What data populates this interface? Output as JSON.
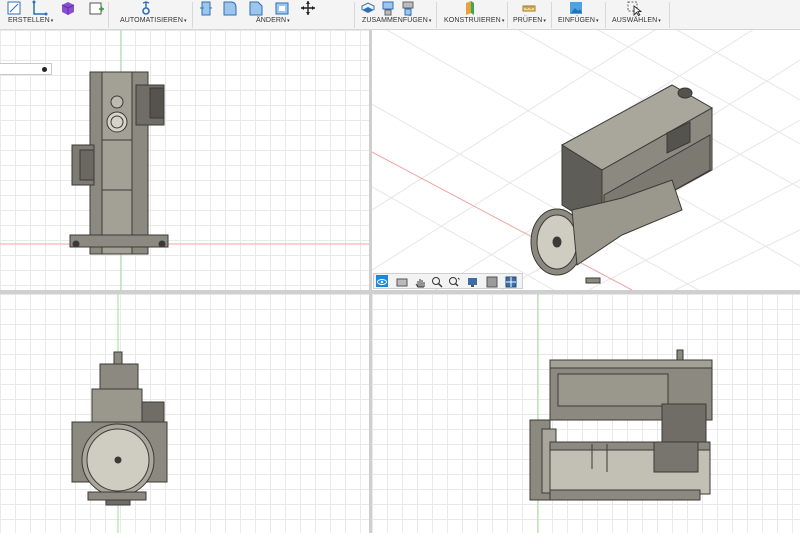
{
  "toolbar": {
    "groups": [
      {
        "label": "ERSTELLEN",
        "icons": [
          "sketch-icon",
          "line-icon",
          "box-icon",
          "create-form-icon"
        ]
      },
      {
        "label": "AUTOMATISIEREN",
        "icons": [
          "automate-icon"
        ]
      },
      {
        "label": "ÄNDERN",
        "icons": [
          "press-pull-icon",
          "fillet-icon",
          "chamfer-icon",
          "shell-icon",
          "move-icon"
        ]
      },
      {
        "label": "ZUSAMMENFÜGEN",
        "icons": [
          "component-icon",
          "joint-icon",
          "as-built-joint-icon"
        ]
      },
      {
        "label": "KONSTRUIEREN",
        "icons": [
          "plane-icon"
        ]
      },
      {
        "label": "PRÜFEN",
        "icons": [
          "measure-icon"
        ]
      },
      {
        "label": "EINFÜGEN",
        "icons": [
          "insert-image-icon"
        ]
      },
      {
        "label": "AUSWÄHLEN",
        "icons": [
          "select-icon"
        ]
      }
    ],
    "caret": "▾"
  },
  "colors": {
    "toolbar_bg": "#f4f4f4",
    "grid_line": "#e9e9e9",
    "axis_red": "#f2a3a3",
    "axis_green": "#9fdc9f",
    "engine_body": "#8c8a80",
    "engine_dark": "#3b3a36",
    "accent_blue": "#1e88d8"
  },
  "viewports": [
    "Oben",
    "Home",
    "Vorne",
    "Rechts"
  ],
  "navbar": {
    "icons": [
      "orbit-icon",
      "look-at-icon",
      "pan-icon",
      "zoom-icon",
      "zoom-window-icon",
      "display-settings-icon",
      "grid-settings-icon",
      "viewports-icon"
    ]
  }
}
